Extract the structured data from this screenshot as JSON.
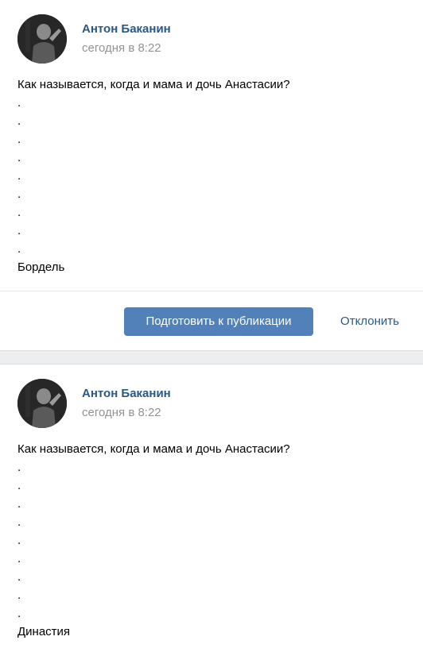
{
  "posts": [
    {
      "author": "Антон Баканин",
      "time": "сегодня в 8:22",
      "lines": [
        "Как называется, когда и мама и дочь Анастасии?",
        ".",
        ".",
        ".",
        ".",
        ".",
        ".",
        ".",
        ".",
        ".",
        "Бордель"
      ]
    },
    {
      "author": "Антон Баканин",
      "time": "сегодня в 8:22",
      "lines": [
        "Как называется, когда и мама и дочь Анастасии?",
        ".",
        ".",
        ".",
        ".",
        ".",
        ".",
        ".",
        ".",
        ".",
        "Династия"
      ]
    }
  ],
  "actions": {
    "prepare_label": "Подготовить к публикации",
    "reject_label": "Отклонить"
  },
  "colors": {
    "link": "#2a5885",
    "button": "#5181b8",
    "muted": "#939393",
    "separator": "#edeef0"
  },
  "icons": {
    "avatar": "user-photo-avatar"
  }
}
